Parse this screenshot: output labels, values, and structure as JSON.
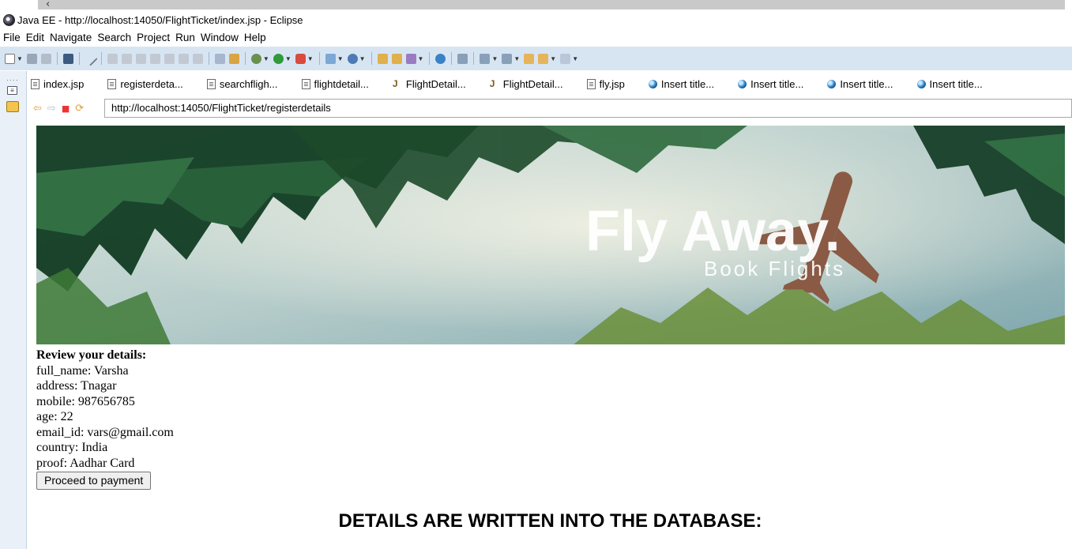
{
  "window": {
    "title": "Java EE - http://localhost:14050/FlightTicket/index.jsp - Eclipse"
  },
  "menu": [
    "File",
    "Edit",
    "Navigate",
    "Search",
    "Project",
    "Run",
    "Window",
    "Help"
  ],
  "toolbar": {
    "icons": [
      "new-icon",
      "save-icon",
      "save-all-icon",
      "console-icon",
      "skip-breakpoints-icon",
      "resume-icon",
      "suspend-icon",
      "terminate-icon",
      "disconnect-icon",
      "step-into-icon",
      "step-over-icon",
      "step-return-icon",
      "drop-to-frame-icon",
      "use-step-filters-icon",
      "debug-icon",
      "run-icon",
      "external-tools-icon",
      "new-server-icon",
      "new-class-icon",
      "open-type-icon",
      "open-task-icon",
      "search-icon",
      "globe-icon",
      "next-annotation-icon",
      "previous-annotation-icon",
      "last-edit-icon",
      "back-icon",
      "forward-icon"
    ]
  },
  "tabs": [
    {
      "label": "index.jsp",
      "icon": "jsp-file-icon"
    },
    {
      "label": "registerdeta...",
      "icon": "jsp-file-icon"
    },
    {
      "label": "searchfligh...",
      "icon": "jsp-file-icon"
    },
    {
      "label": "flightdetail...",
      "icon": "jsp-file-icon"
    },
    {
      "label": "FlightDetail...",
      "icon": "java-file-icon"
    },
    {
      "label": "FlightDetail...",
      "icon": "java-file-icon"
    },
    {
      "label": "fly.jsp",
      "icon": "jsp-file-icon"
    },
    {
      "label": "Insert title...",
      "icon": "browser-globe-icon"
    },
    {
      "label": "Insert title...",
      "icon": "browser-globe-icon"
    },
    {
      "label": "Insert title...",
      "icon": "browser-globe-icon"
    },
    {
      "label": "Insert title...",
      "icon": "browser-globe-icon"
    }
  ],
  "browser": {
    "url": "http://localhost:14050/FlightTicket/registerdetails",
    "icons": [
      "back-arrow-icon",
      "forward-arrow-icon",
      "stop-icon",
      "refresh-icon"
    ]
  },
  "banner": {
    "title": "Fly Away.",
    "subtitle": "Book Flights"
  },
  "details": {
    "heading": "Review your details:",
    "rows": [
      "full_name: Varsha",
      "address: Tnagar",
      "mobile: 987656785",
      "age: 22",
      "email_id: vars@gmail.com",
      "country: India",
      "proof: Aadhar Card"
    ],
    "button_label": "Proceed to payment"
  },
  "caption": "DETAILS ARE WRITTEN INTO THE DATABASE:"
}
